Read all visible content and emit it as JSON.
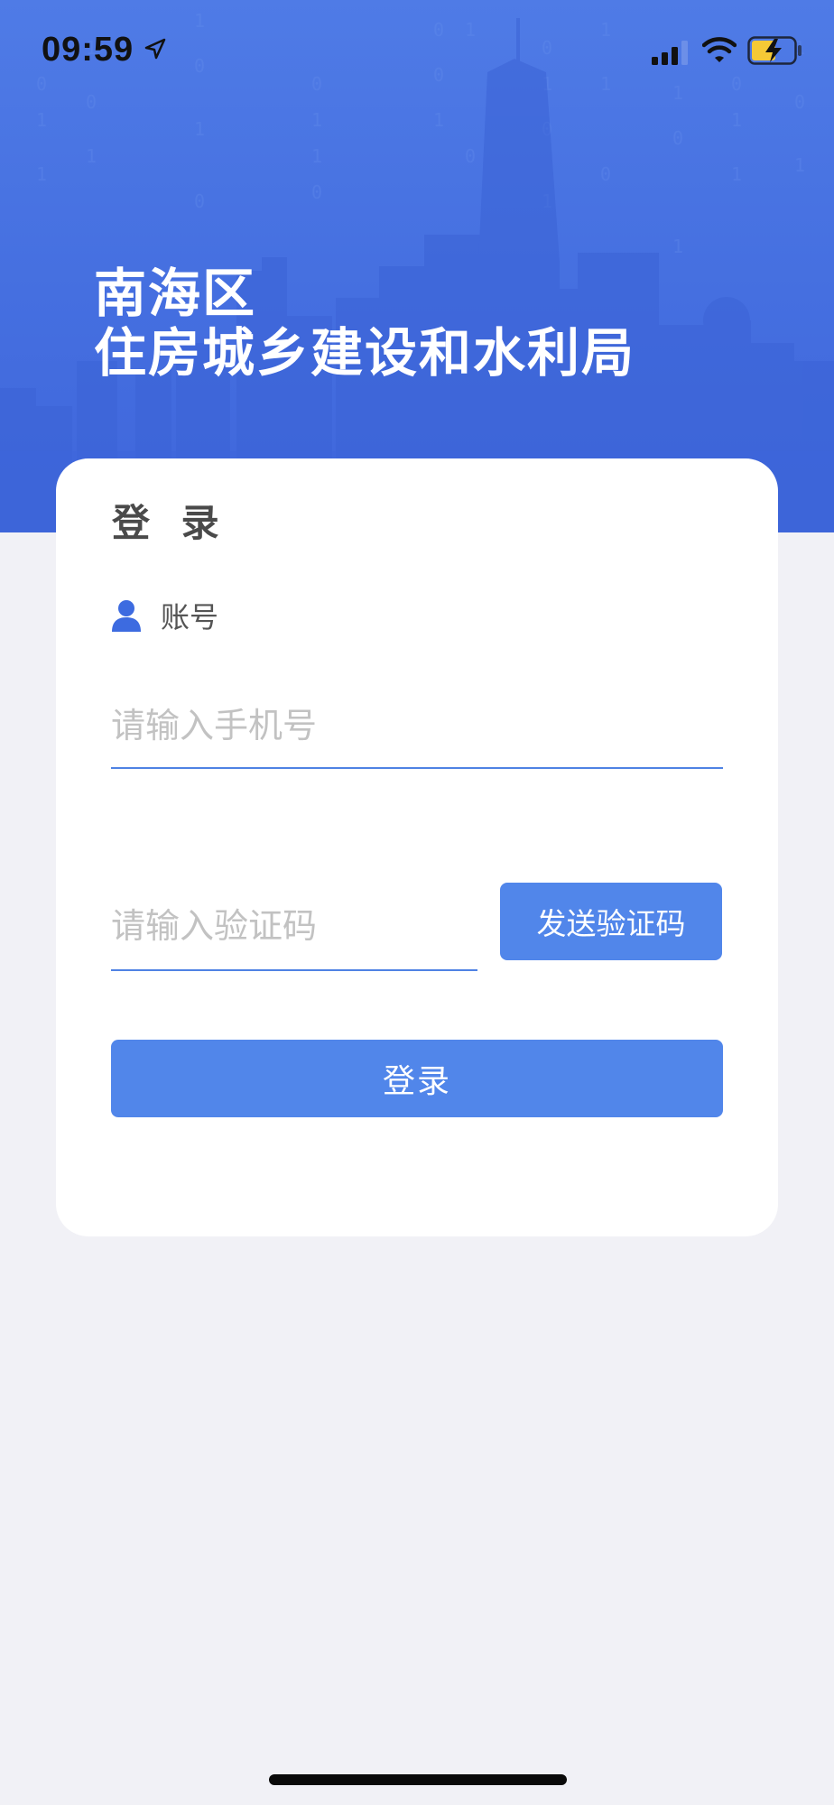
{
  "status_bar": {
    "time": "09:59",
    "icons": [
      "location-arrow-icon",
      "cellular-signal-icon",
      "wifi-icon",
      "battery-charging-icon"
    ]
  },
  "header": {
    "title_line1": "南海区",
    "title_line2": "住房城乡建设和水利局",
    "background": "city-skyline-with-binary-code"
  },
  "login_card": {
    "title": "登 录",
    "account_icon": "user-icon",
    "account_label": "账号",
    "phone_placeholder": "请输入手机号",
    "phone_value": "",
    "code_placeholder": "请输入验证码",
    "code_value": "",
    "send_code_label": "发送验证码",
    "login_label": "登录"
  },
  "colors": {
    "header_blue": "#4a74e2",
    "accent_blue": "#5186ea",
    "page_background": "#f1f1f6",
    "card_background": "#ffffff",
    "placeholder_gray": "#c2c2c2"
  }
}
